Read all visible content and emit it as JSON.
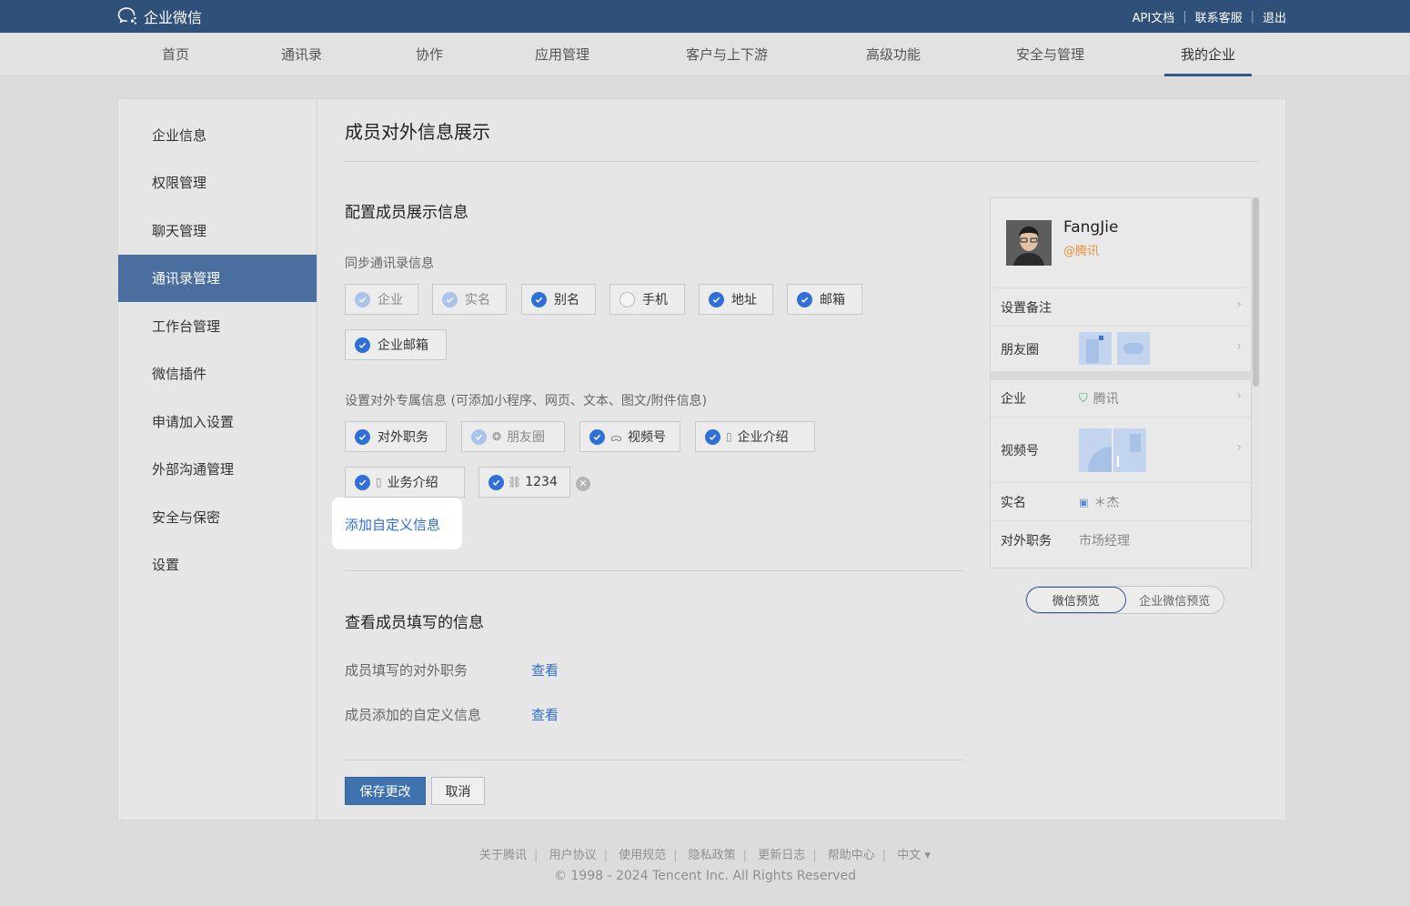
{
  "app": {
    "logo_text": "企业微信"
  },
  "top_links": [
    "API文档",
    "联系客服",
    "退出"
  ],
  "nav": [
    {
      "label": "首页"
    },
    {
      "label": "通讯录"
    },
    {
      "label": "协作"
    },
    {
      "label": "应用管理"
    },
    {
      "label": "客户与上下游"
    },
    {
      "label": "高级功能"
    },
    {
      "label": "安全与管理"
    },
    {
      "label": "我的企业",
      "active": true
    }
  ],
  "sidebar": {
    "items": [
      {
        "label": "企业信息"
      },
      {
        "label": "权限管理"
      },
      {
        "label": "聊天管理"
      },
      {
        "label": "通讯录管理",
        "active": true
      },
      {
        "label": "工作台管理"
      },
      {
        "label": "微信插件"
      },
      {
        "label": "申请加入设置"
      },
      {
        "label": "外部沟通管理"
      },
      {
        "label": "安全与保密"
      },
      {
        "label": "设置"
      }
    ]
  },
  "main": {
    "title": "成员对外信息展示",
    "config_title": "配置成员展示信息",
    "sync_label": "同步通讯录信息",
    "sync_options": [
      {
        "label": "企业",
        "state": "disabled"
      },
      {
        "label": "实名",
        "state": "disabled"
      },
      {
        "label": "别名",
        "state": "checked"
      },
      {
        "label": "手机",
        "state": "unchecked"
      },
      {
        "label": "地址",
        "state": "checked"
      },
      {
        "label": "邮箱",
        "state": "checked"
      },
      {
        "label": "企业邮箱",
        "state": "checked"
      }
    ],
    "exclusive_label": "设置对外专属信息 (可添加小程序、网页、文本、图文/附件信息)",
    "exclusive_options": [
      {
        "label": "对外职务",
        "state": "checked",
        "icon": ""
      },
      {
        "label": "朋友圈",
        "state": "disabled",
        "icon": "moments-icon"
      },
      {
        "label": "视频号",
        "state": "checked",
        "icon": "channels-icon"
      },
      {
        "label": "企业介绍",
        "state": "checked",
        "icon": "document-icon"
      },
      {
        "label": "业务介绍",
        "state": "checked",
        "icon": "document-icon"
      },
      {
        "label": "1234",
        "state": "checked",
        "icon": "link-icon"
      }
    ],
    "add_custom": "添加自定义信息",
    "view_title": "查看成员填写的信息",
    "view_rows": [
      {
        "label": "成员填写的对外职务",
        "link": "查看"
      },
      {
        "label": "成员添加的自定义信息",
        "link": "查看"
      }
    ],
    "save_label": "保存更改",
    "cancel_label": "取消"
  },
  "preview": {
    "name": "FangJie",
    "org": "@腾讯",
    "rows": [
      {
        "label": "设置备注",
        "value": ""
      },
      {
        "label": "朋友圈",
        "value": ""
      },
      {
        "label": "企业",
        "value": "腾讯"
      },
      {
        "label": "视频号",
        "value": ""
      },
      {
        "label": "实名",
        "value": "＊杰"
      },
      {
        "label": "对外职务",
        "value": "市场经理"
      }
    ],
    "toggle": [
      {
        "label": "微信预览",
        "active": true
      },
      {
        "label": "企业微信预览",
        "active": false
      }
    ]
  },
  "footer": {
    "links": [
      "关于腾讯",
      "用户协议",
      "使用规范",
      "隐私政策",
      "更新日志",
      "帮助中心",
      "中文 ▾"
    ],
    "copyright": "© 1998 - 2024 Tencent Inc. All Rights Reserved"
  },
  "colors": {
    "brand": "#2f5079",
    "accent": "#2f6fd6",
    "save": "#3f72ae"
  }
}
